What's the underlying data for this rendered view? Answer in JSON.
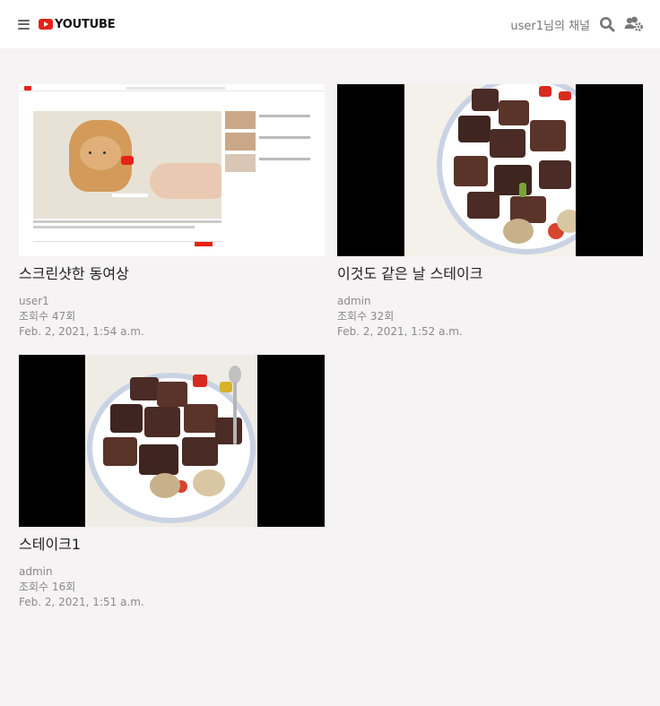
{
  "header": {
    "logo_text": "YOUTUBE",
    "channel_user": "user1",
    "channel_suffix": "님의 채널",
    "icons": [
      "menu-icon",
      "youtube-logo-icon",
      "search-icon",
      "users-cog-icon"
    ]
  },
  "videos": [
    {
      "title": "스크린샷한 동여상",
      "author": "user1",
      "views": "조회수 47회",
      "date": "Feb. 2, 2021, 1:54 a.m.",
      "thumbnail": "screenshot"
    },
    {
      "title": "이것도 같은 날 스테이크",
      "author": "admin",
      "views": "조회수 32회",
      "date": "Feb. 2, 2021, 1:52 a.m.",
      "thumbnail": "steak"
    },
    {
      "title": "스테이크1",
      "author": "admin",
      "views": "조회수 16회",
      "date": "Feb. 2, 2021, 1:51 a.m.",
      "thumbnail": "steak"
    }
  ],
  "colors": {
    "brand_red": "#e62117",
    "page_bg": "#f5f3f4",
    "meta_text": "#8a8a8a"
  }
}
